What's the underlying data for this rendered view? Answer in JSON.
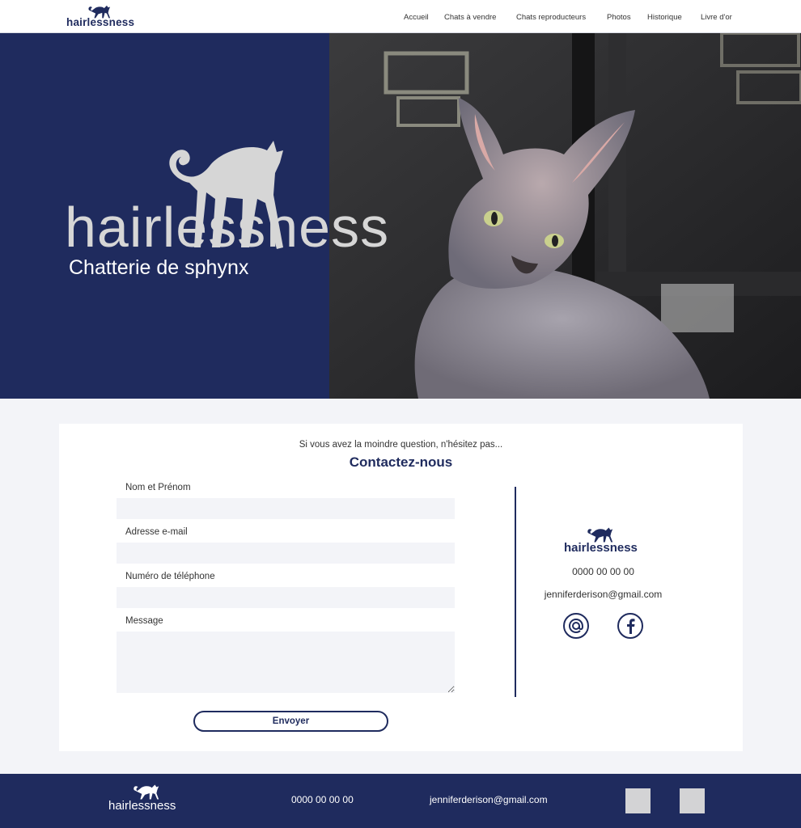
{
  "brand": {
    "name": "hairlessness",
    "tagline": "Chatterie de sphynx"
  },
  "nav": {
    "items": [
      {
        "label": "Accueil"
      },
      {
        "label": "Chats à vendre"
      },
      {
        "label": "Chats reproducteurs"
      },
      {
        "label": "Photos"
      },
      {
        "label": "Historique"
      },
      {
        "label": "Livre d'or"
      }
    ]
  },
  "contact": {
    "intro": "Si vous avez la moindre question, n'hésitez pas...",
    "title": "Contactez-nous",
    "fields": [
      {
        "label": "Nom et Prénom",
        "value": ""
      },
      {
        "label": "Adresse e-mail",
        "value": ""
      },
      {
        "label": "Numéro de téléphone",
        "value": ""
      },
      {
        "label": "Message",
        "value": ""
      }
    ],
    "submit_label": "Envoyer",
    "phone": "0000 00 00 00",
    "email": "jenniferderison@gmail.com",
    "icons": [
      "at-sign-icon",
      "facebook-icon"
    ]
  },
  "footer": {
    "phone": "0000 00 00 00",
    "email": "jenniferderison@gmail.com"
  },
  "colors": {
    "primary": "#1f2b5e",
    "background": "#f3f4f8",
    "logo_gray": "#d6d6d6"
  }
}
